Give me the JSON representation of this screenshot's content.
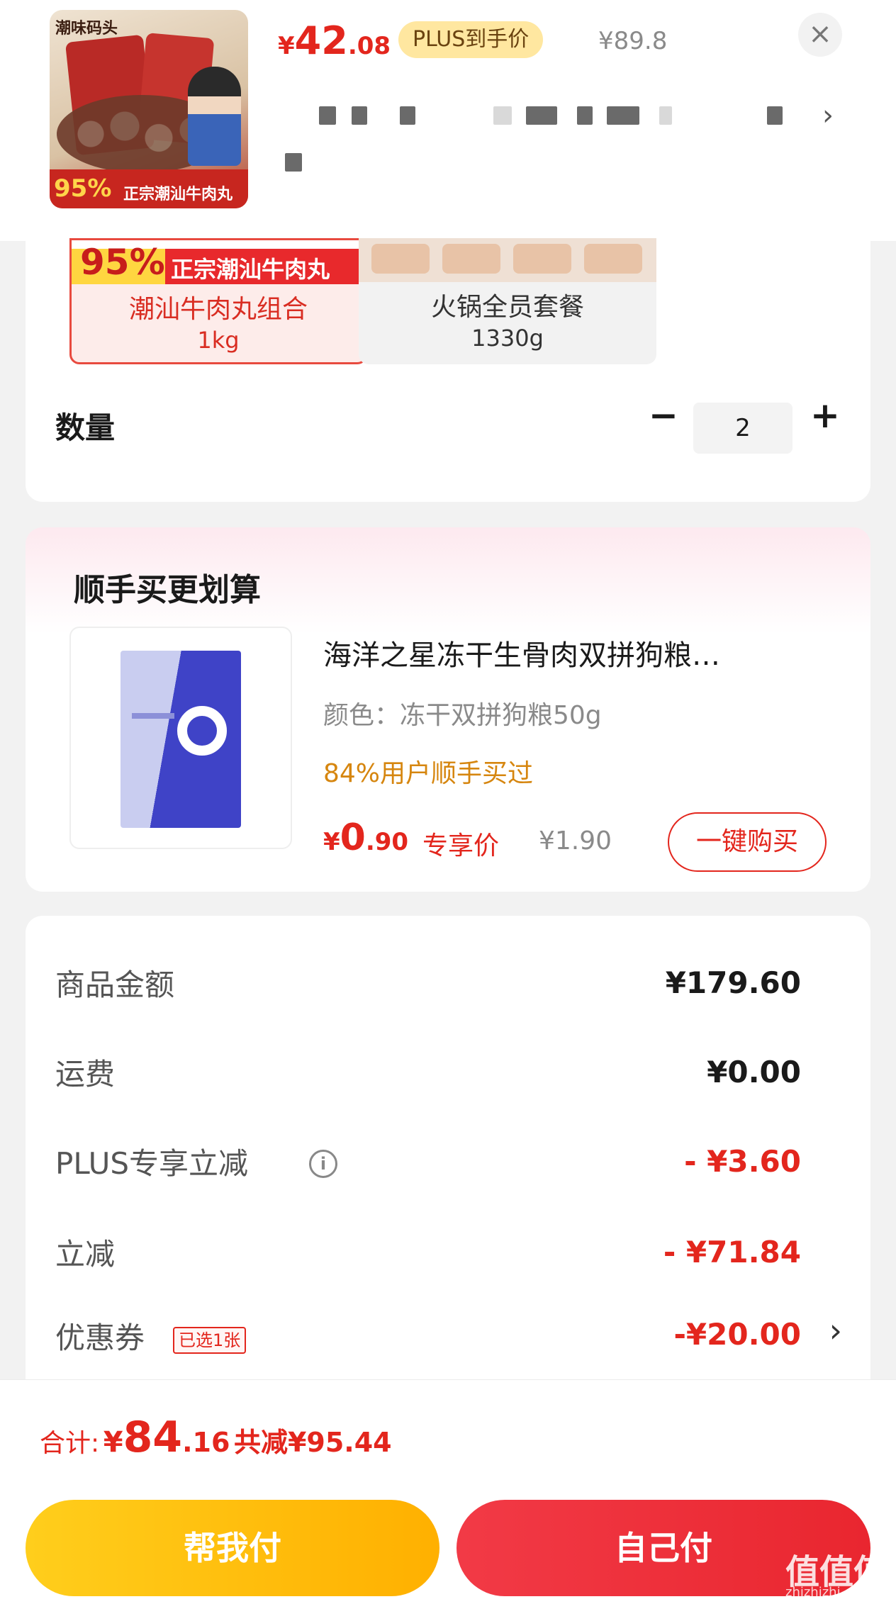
{
  "product": {
    "thumbnail_brand": "潮味码头",
    "thumbnail_percent": "95%",
    "thumbnail_slogan": "正宗潮汕牛肉丸",
    "price_currency": "¥",
    "price_int": "42",
    "price_dec": ".08",
    "plus_tag": "PLUS到手价",
    "original_price": "¥89.8",
    "close_icon": "×",
    "spec_arrow": "›"
  },
  "spec": {
    "options": [
      {
        "percent": "95%",
        "slogan": "正宗潮汕牛肉丸",
        "name": "潮汕牛肉丸组合",
        "weight": "1kg",
        "selected": true
      },
      {
        "name": "火锅全员套餐",
        "weight": "1330g",
        "selected": false
      }
    ],
    "quantity_label": "数量",
    "quantity_minus": "−",
    "quantity_value": "2",
    "quantity_plus": "+"
  },
  "addon": {
    "title": "顺手买更划算",
    "name": "海洋之星冻干生骨肉双拼狗粮…",
    "variant": "颜色：冻干双拼狗粮50g",
    "social_proof": "84%用户顺手买过",
    "price_currency": "¥",
    "price_int": "0",
    "price_dec": ".90",
    "exclusive_label": "专享价",
    "original_price": "¥1.90",
    "buy_button": "一键购买"
  },
  "summary": {
    "rows": [
      {
        "label": "商品金额",
        "value": "¥179.60"
      },
      {
        "label": "运费",
        "value": "¥0.00"
      },
      {
        "label": "PLUS专享立减",
        "value": "- ¥3.60"
      },
      {
        "label": "立减",
        "value": "- ¥71.84"
      },
      {
        "label": "优惠券",
        "value": "-¥20.00",
        "badge": "已选1张"
      }
    ],
    "info_icon": "i",
    "coupon_arrow": "›"
  },
  "total": {
    "label": "合计:",
    "currency": "¥",
    "int": "84",
    "dec": ".16",
    "saved": "共减¥95.44"
  },
  "actions": {
    "help_pay": "帮我付",
    "self_pay": "自己付"
  },
  "watermark": {
    "text": "值值值",
    "url": "zhizhizhi.com"
  },
  "colors": {
    "accent_red": "#e3261d",
    "plus_gold": "#ffe7a0",
    "help_button": "#ffb000",
    "self_button": "#e9262f"
  }
}
